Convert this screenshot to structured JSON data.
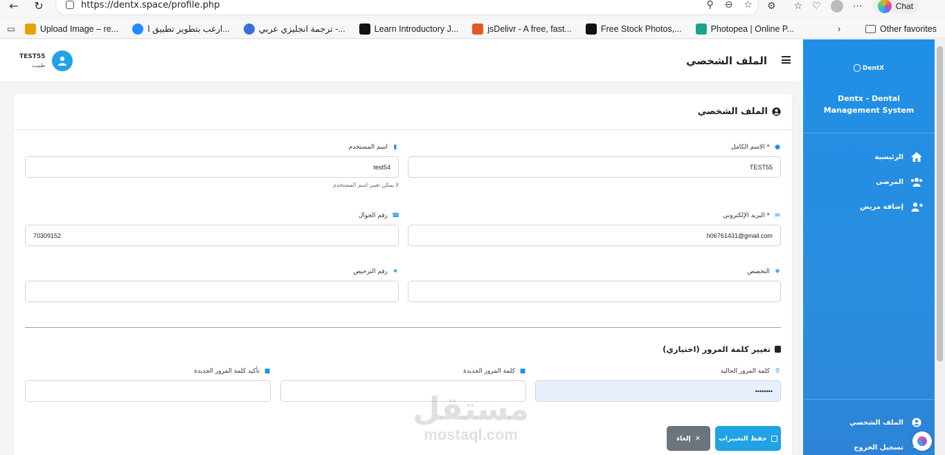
{
  "browser": {
    "url": "https://dentx.space/profile.php",
    "chat_label": "Chat",
    "bookmarks": [
      {
        "label": "Upload Image – re...",
        "color": "#e8a200"
      },
      {
        "label": "ارغب بتطوير تطبيق ا...",
        "color": "#1a8cff"
      },
      {
        "label": "ترجمة انجليزي عربي -...",
        "color": "#3b6fd8"
      },
      {
        "label": "Learn Introductory J...",
        "color": "#111111"
      },
      {
        "label": "jsDelivr - A free, fast...",
        "color": "#e05a24"
      },
      {
        "label": "Free Stock Photos,...",
        "color": "#111111"
      },
      {
        "label": "Photopea | Online P...",
        "color": "#19a58a"
      }
    ],
    "other_favorites": "Other favorites"
  },
  "user": {
    "name": "TEST55",
    "role": "طبيب"
  },
  "header": {
    "title": "الملف الشخصي"
  },
  "sidebar": {
    "logo": "DentX",
    "title": "Dentx - Dental Management System",
    "items": [
      {
        "label": "الرئيسية",
        "icon": "home-icon"
      },
      {
        "label": "المرضى",
        "icon": "users-icon"
      },
      {
        "label": "إضافة مريض",
        "icon": "user-plus-icon"
      }
    ],
    "bottom_items": [
      {
        "label": "الملف الشخصي",
        "icon": "user-circle-icon"
      },
      {
        "label": "تسجيل الخروج",
        "icon": "logout-icon"
      }
    ]
  },
  "card": {
    "title": "الملف الشخصي"
  },
  "form": {
    "full_name": {
      "label": "الاسم الكامل *",
      "value": "TEST55"
    },
    "username": {
      "label": "اسم المستخدم",
      "value": "test54",
      "hint": "لا يمكن تغيير اسم المستخدم"
    },
    "email": {
      "label": "البريد الإلكتروني *",
      "value": "h06761431@gmail.com"
    },
    "phone": {
      "label": "رقم الجوال",
      "value": "70309152"
    },
    "specialty": {
      "label": "التخصص",
      "value": ""
    },
    "license": {
      "label": "رقم الترخيص",
      "value": ""
    }
  },
  "password": {
    "title": "تغيير كلمة المرور (اختياري)",
    "current": {
      "label": "كلمة المرور الحالية",
      "value": "••••••••"
    },
    "new": {
      "label": "كلمة المرور الجديدة",
      "value": ""
    },
    "confirm": {
      "label": "تأكيد كلمة المرور الجديدة",
      "value": ""
    }
  },
  "buttons": {
    "save": "حفظ التغييرات",
    "cancel": "إلغاء"
  },
  "watermark": {
    "ar": "مستقل",
    "en": "mostaql.com"
  }
}
